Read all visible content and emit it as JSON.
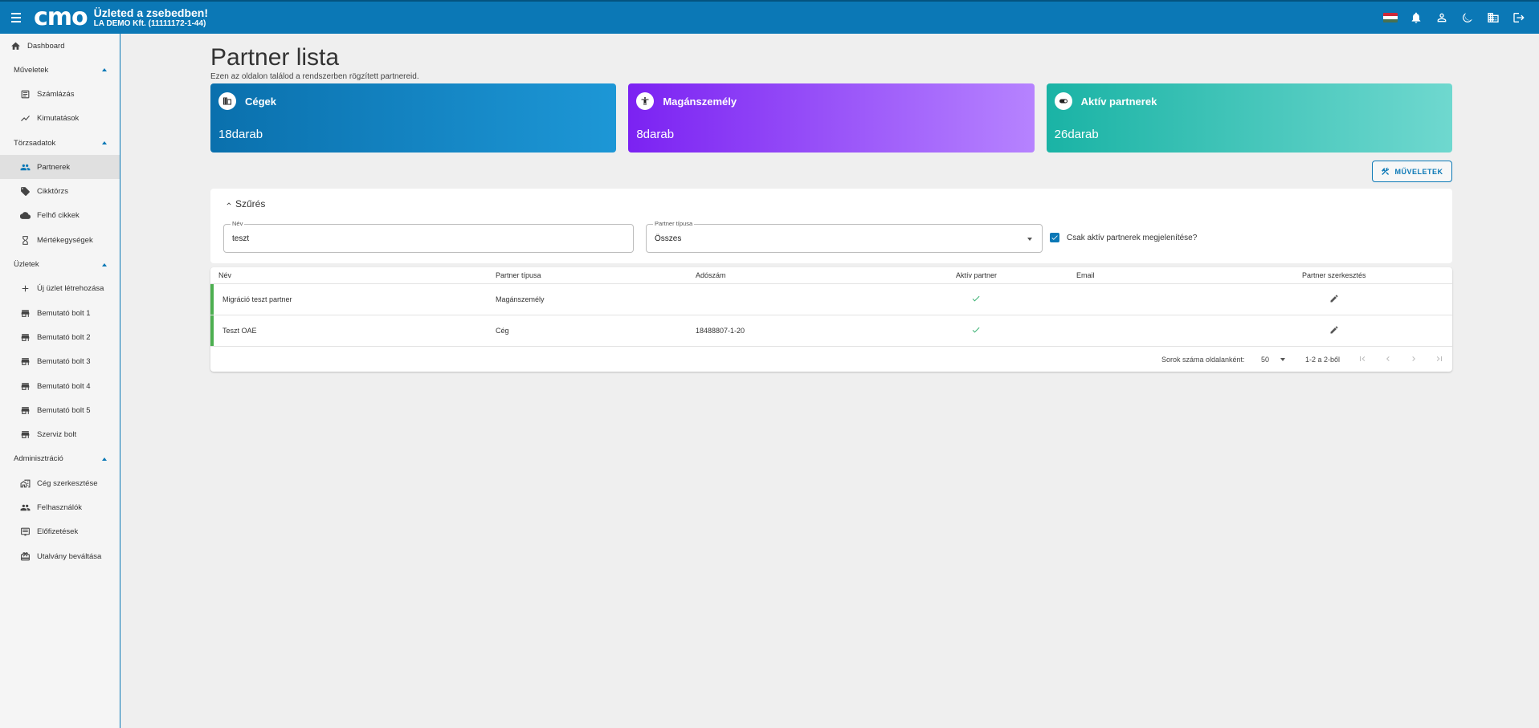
{
  "header": {
    "logo_text": "cmo",
    "title": "Üzleted a zsebedben!",
    "company": "LA DEMO Kft. (11111172-1-44)",
    "flag_colors": [
      "#ce2939",
      "#ffffff",
      "#477050"
    ],
    "icons": [
      "hungary-flag-icon",
      "bell-icon",
      "user-icon",
      "moon-icon",
      "building-icon",
      "logout-icon"
    ]
  },
  "sidebar": {
    "dashboard": "Dashboard",
    "sections": [
      {
        "label": "Műveletek",
        "items": [
          "Számlázás",
          "Kimutatások"
        ]
      },
      {
        "label": "Törzsadatok",
        "items": [
          "Partnerek",
          "Cikktörzs",
          "Felhő cikkek",
          "Mértékegységek"
        ]
      },
      {
        "label": "Üzletek",
        "items": [
          "Új üzlet létrehozása",
          "Bemutató bolt 1",
          "Bemutató bolt 2",
          "Bemutató bolt 3",
          "Bemutató bolt 4",
          "Bemutató bolt 5",
          "Szerviz bolt"
        ]
      },
      {
        "label": "Adminisztráció",
        "items": [
          "Cég szerkesztése",
          "Felhasználók",
          "Előfizetések",
          "Utalvány beváltása"
        ]
      }
    ]
  },
  "page": {
    "title": "Partner lista",
    "subtitle": "Ezen az oldalon találod a rendszerben rögzített partnereid."
  },
  "cards": [
    {
      "title": "Cégek",
      "value": "18darab"
    },
    {
      "title": "Magánszemély",
      "value": "8darab"
    },
    {
      "title": "Aktív partnerek",
      "value": "26darab"
    }
  ],
  "actions_button": "MŰVELETEK",
  "filter": {
    "title": "Szűrés",
    "name_label": "Név",
    "name_value": "teszt",
    "type_label": "Partner típusa",
    "type_value": "Összes",
    "active_only_label": "Csak aktív partnerek megjelenítése?",
    "active_only_checked": true
  },
  "table": {
    "columns": [
      "Név",
      "Partner típusa",
      "Adószám",
      "Aktív partner",
      "Email",
      "Partner szerkesztés"
    ],
    "rows": [
      {
        "name": "Migráció teszt partner",
        "type": "Magánszemély",
        "tax": "",
        "active": true,
        "email": ""
      },
      {
        "name": "Teszt OAE",
        "type": "Cég",
        "tax": "18488807-1-20",
        "active": true,
        "email": ""
      }
    ],
    "rows_per_page_label": "Sorok száma oldalanként:",
    "rows_per_page": "50",
    "range": "1-2 a 2-ből"
  }
}
